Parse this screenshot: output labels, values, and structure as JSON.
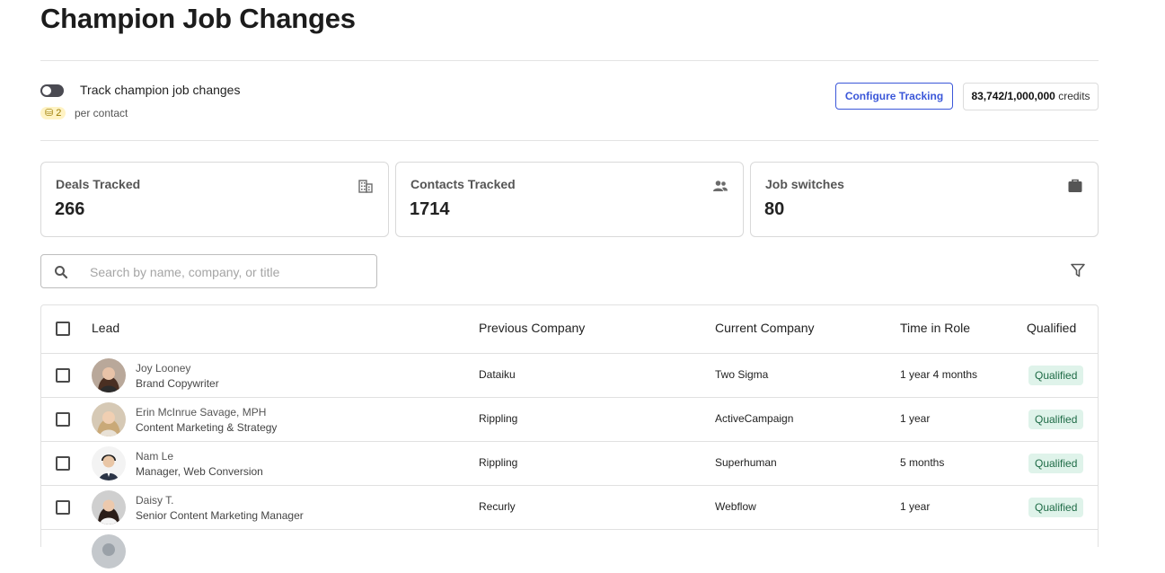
{
  "header": {
    "title": "Champion Job Changes"
  },
  "tracking": {
    "toggle_label": "Track champion job changes",
    "cost": "2",
    "cost_unit": "per contact",
    "configure_label": "Configure Tracking",
    "credits_used": "83,742/1,000,000",
    "credits_suffix": "credits"
  },
  "stats": [
    {
      "label": "Deals Tracked",
      "value": "266",
      "icon": "building-icon"
    },
    {
      "label": "Contacts Tracked",
      "value": "1714",
      "icon": "people-icon"
    },
    {
      "label": "Job switches",
      "value": "80",
      "icon": "briefcase-icon"
    }
  ],
  "search": {
    "placeholder": "Search by name, company, or title"
  },
  "table": {
    "columns": [
      "Lead",
      "Previous Company",
      "Current Company",
      "Time in Role",
      "Qualified"
    ],
    "rows": [
      {
        "name": "Joy Looney",
        "title": "Brand Copywriter",
        "previous": "Dataiku",
        "current": "Two Sigma",
        "time": "1 year 4 months",
        "qualified": "Qualified"
      },
      {
        "name": "Erin McInrue Savage, MPH",
        "title": "Content Marketing & Strategy",
        "previous": "Rippling",
        "current": "ActiveCampaign",
        "time": "1 year",
        "qualified": "Qualified"
      },
      {
        "name": "Nam Le",
        "title": "Manager, Web Conversion",
        "previous": "Rippling",
        "current": "Superhuman",
        "time": "5 months",
        "qualified": "Qualified"
      },
      {
        "name": "Daisy T.",
        "title": "Senior Content Marketing Manager",
        "previous": "Recurly",
        "current": "Webflow",
        "time": "1 year",
        "qualified": "Qualified"
      }
    ]
  },
  "colors": {
    "accent": "#3b57d9",
    "qualified_bg": "#dff3ea",
    "qualified_text": "#1e6b46",
    "cost_badge_bg": "#fff3c4"
  }
}
